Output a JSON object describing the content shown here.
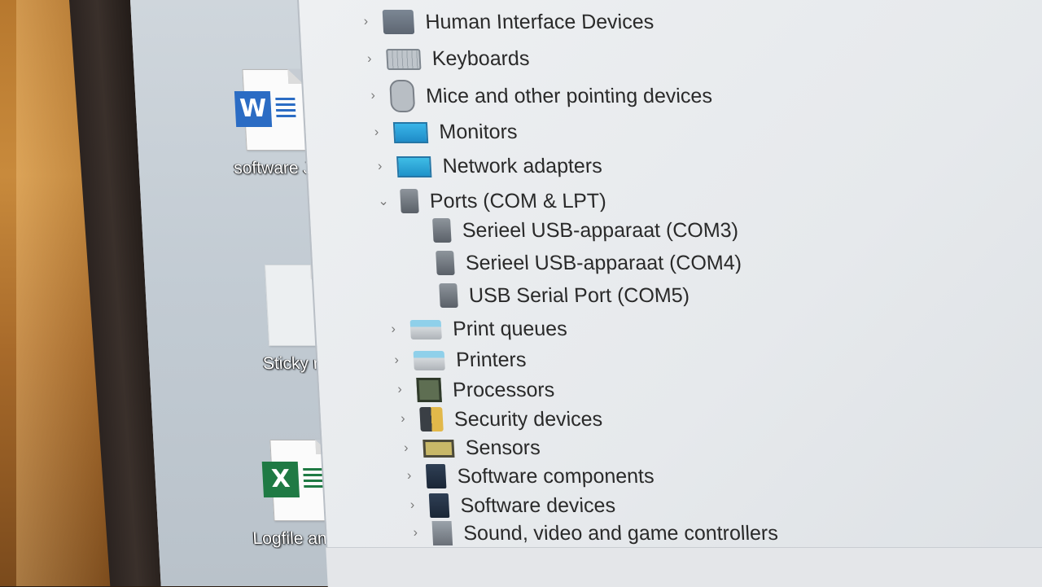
{
  "desktop": {
    "icons": [
      {
        "label": "software Jo",
        "icon": "word-doc-icon",
        "badge": "W"
      },
      {
        "label": "Sticky not",
        "icon": "blank-doc-icon",
        "badge": ""
      },
      {
        "label": "Logfile analys",
        "icon": "excel-doc-icon",
        "badge": "X"
      }
    ]
  },
  "device_tree": {
    "items": [
      {
        "label": "Human Interface Devices",
        "expanded": false,
        "icon": "hid-icon"
      },
      {
        "label": "Keyboards",
        "expanded": false,
        "icon": "keyboard-icon"
      },
      {
        "label": "Mice and other pointing devices",
        "expanded": false,
        "icon": "mouse-icon"
      },
      {
        "label": "Monitors",
        "expanded": false,
        "icon": "monitor-icon"
      },
      {
        "label": "Network adapters",
        "expanded": false,
        "icon": "network-icon"
      },
      {
        "label": "Ports (COM & LPT)",
        "expanded": true,
        "icon": "port-icon",
        "children": [
          {
            "label": "Serieel USB-apparaat (COM3)",
            "icon": "port-icon"
          },
          {
            "label": "Serieel USB-apparaat (COM4)",
            "icon": "port-icon"
          },
          {
            "label": "USB Serial Port (COM5)",
            "icon": "port-icon"
          }
        ]
      },
      {
        "label": "Print queues",
        "expanded": false,
        "icon": "printer-icon"
      },
      {
        "label": "Printers",
        "expanded": false,
        "icon": "printer-icon"
      },
      {
        "label": "Processors",
        "expanded": false,
        "icon": "processor-icon"
      },
      {
        "label": "Security devices",
        "expanded": false,
        "icon": "security-icon"
      },
      {
        "label": "Sensors",
        "expanded": false,
        "icon": "sensor-icon"
      },
      {
        "label": "Software components",
        "expanded": false,
        "icon": "software-icon"
      },
      {
        "label": "Software devices",
        "expanded": false,
        "icon": "software-icon"
      },
      {
        "label": "Sound, video and game controllers",
        "expanded": false,
        "icon": "sound-icon"
      }
    ]
  }
}
